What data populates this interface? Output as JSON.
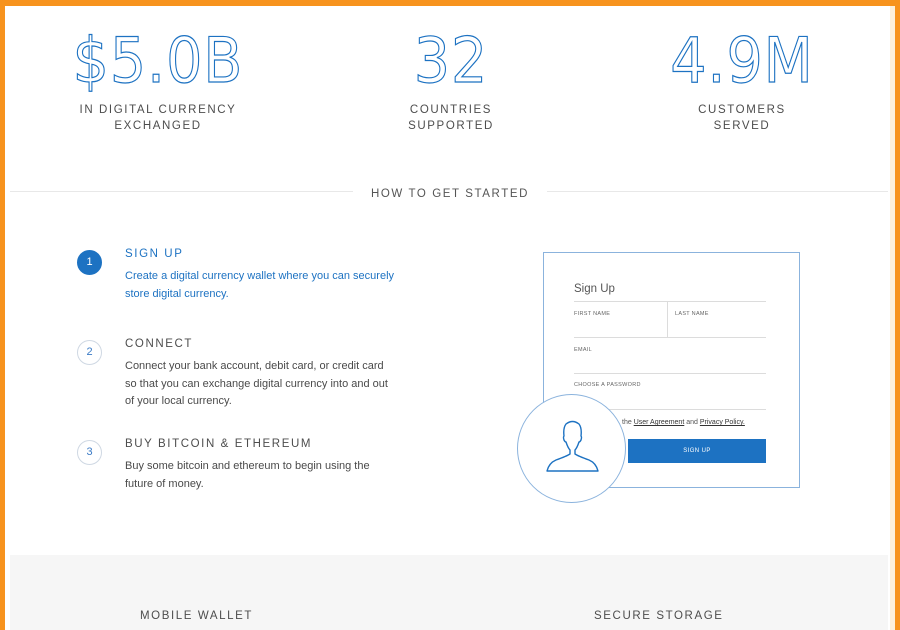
{
  "stats": [
    {
      "value": "$5.0B",
      "label_line1": "IN DIGITAL CURRENCY",
      "label_line2": "EXCHANGED"
    },
    {
      "value": "32",
      "label_line1": "COUNTRIES",
      "label_line2": "SUPPORTED"
    },
    {
      "value": "4.9M",
      "label_line1": "CUSTOMERS",
      "label_line2": "SERVED"
    }
  ],
  "section_title": "HOW TO GET STARTED",
  "steps": [
    {
      "num": "1",
      "title": "SIGN UP",
      "desc": "Create a digital currency wallet where you can securely store digital currency."
    },
    {
      "num": "2",
      "title": "CONNECT",
      "desc": "Connect your bank account, debit card, or credit card so that you can exchange digital currency into and out of your local currency."
    },
    {
      "num": "3",
      "title": "BUY BITCOIN & ETHEREUM",
      "desc": "Buy some bitcoin and ethereum to begin using the future of money."
    }
  ],
  "signup_card": {
    "title": "Sign Up",
    "first_name": "FIRST NAME",
    "last_name": "LAST NAME",
    "email": "EMAIL",
    "password": "CHOOSE A PASSWORD",
    "agree_prefix": "the",
    "agreement_link": "User Agreement",
    "agree_and": "and",
    "privacy_link": "Privacy Policy.",
    "button": "SIGN UP"
  },
  "features": {
    "left": "MOBILE WALLET",
    "right": "SECURE STORAGE"
  },
  "colors": {
    "accent": "#1d72c2",
    "frame": "#f7931e"
  }
}
